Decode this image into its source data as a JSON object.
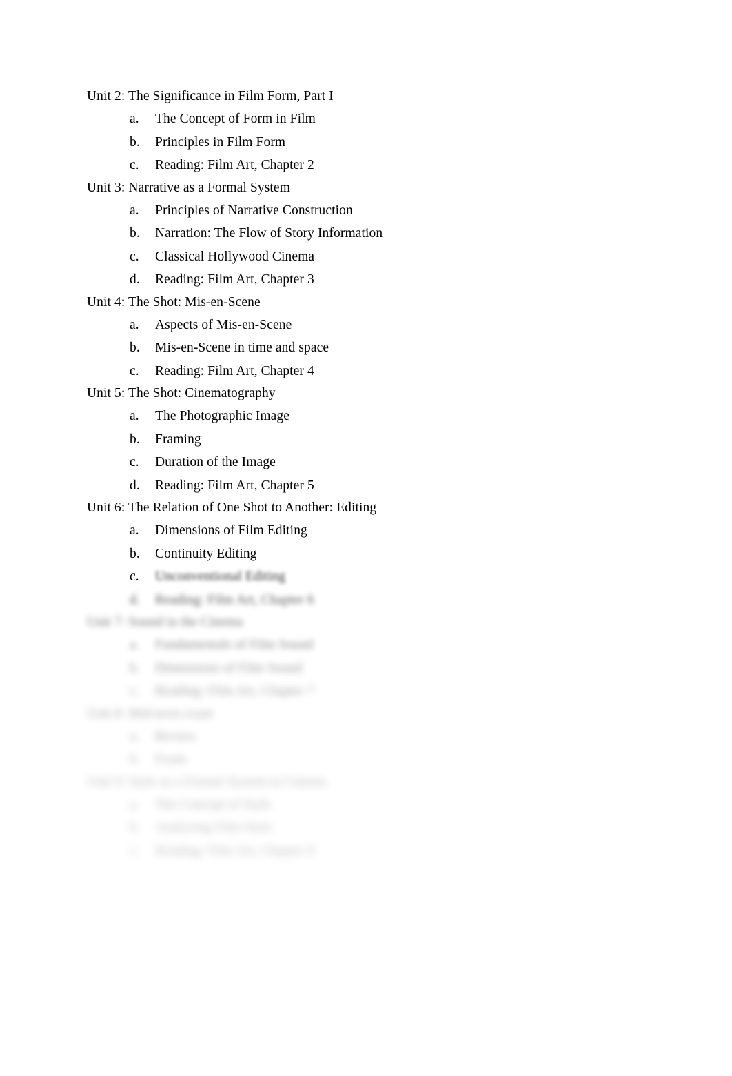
{
  "document": {
    "type": "course-syllabus-outline",
    "page_background": "#ffffff",
    "text_color": "#000000"
  },
  "units": [
    {
      "title": "Unit 2: The Significance in Film Form, Part I",
      "blur_level": 0,
      "items": [
        {
          "marker": "a.",
          "text": "The Concept of Form in Film",
          "blur_level": 0
        },
        {
          "marker": "b.",
          "text": "Principles in Film Form",
          "blur_level": 0
        },
        {
          "marker": "c.",
          "text": "Reading: Film Art, Chapter 2",
          "blur_level": 0
        }
      ]
    },
    {
      "title": "Unit 3: Narrative as a Formal System",
      "blur_level": 0,
      "items": [
        {
          "marker": "a.",
          "text": "Principles of Narrative Construction",
          "blur_level": 0
        },
        {
          "marker": "b.",
          "text": "Narration: The Flow of Story Information",
          "blur_level": 0
        },
        {
          "marker": "c.",
          "text": "Classical Hollywood Cinema",
          "blur_level": 0
        },
        {
          "marker": "d.",
          "text": "Reading: Film Art, Chapter 3",
          "blur_level": 0
        }
      ]
    },
    {
      "title": "Unit 4: The Shot: Mis-en-Scene",
      "blur_level": 0,
      "items": [
        {
          "marker": "a.",
          "text": "Aspects of Mis-en-Scene",
          "blur_level": 0
        },
        {
          "marker": "b.",
          "text": "Mis-en-Scene in time and space",
          "blur_level": 0
        },
        {
          "marker": "c.",
          "text": "Reading: Film Art, Chapter 4",
          "blur_level": 0
        }
      ]
    },
    {
      "title": "Unit 5: The Shot: Cinematography",
      "blur_level": 0,
      "items": [
        {
          "marker": "a.",
          "text": "The Photographic Image",
          "blur_level": 0
        },
        {
          "marker": "b.",
          "text": "Framing",
          "blur_level": 0
        },
        {
          "marker": "c.",
          "text": "Duration of the Image",
          "blur_level": 0
        },
        {
          "marker": "d.",
          "text": "Reading: Film Art, Chapter 5",
          "blur_level": 0
        }
      ]
    },
    {
      "title": "Unit 6: The Relation of One Shot to Another: Editing",
      "blur_level": 0,
      "items": [
        {
          "marker": "a.",
          "text": "Dimensions of Film Editing",
          "blur_level": 0
        },
        {
          "marker": "b.",
          "text": "Continuity Editing",
          "blur_level": 0
        },
        {
          "marker": "c.",
          "text": "Unconventional Editing",
          "blur_level": 1,
          "marker_sharp": true
        },
        {
          "marker": "d.",
          "text": "Reading: Film Art, Chapter 6",
          "blur_level": 2
        }
      ]
    },
    {
      "title": "Unit 7: Sound in the Cinema",
      "blur_level": 3,
      "items": [
        {
          "marker": "a.",
          "text": "Fundamentals of Film Sound",
          "blur_level": 4
        },
        {
          "marker": "b.",
          "text": "Dimensions of Film Sound",
          "blur_level": 5
        },
        {
          "marker": "c.",
          "text": "Reading: Film Art, Chapter 7",
          "blur_level": 6
        }
      ]
    },
    {
      "title": "Unit 8: Mid-term exam",
      "blur_level": 7,
      "items": [
        {
          "marker": "a.",
          "text": "Review",
          "blur_level": 7
        },
        {
          "marker": "b.",
          "text": "Exam",
          "blur_level": 8
        }
      ]
    },
    {
      "title": "Unit 9: Style as a Formal System in Cinema",
      "blur_level": 9,
      "items": [
        {
          "marker": "a.",
          "text": "The Concept of Style",
          "blur_level": 9
        },
        {
          "marker": "b.",
          "text": "Analyzing Film Style",
          "blur_level": 10
        },
        {
          "marker": "c.",
          "text": "Reading: Film Art, Chapter 8",
          "blur_level": 10
        }
      ]
    }
  ]
}
